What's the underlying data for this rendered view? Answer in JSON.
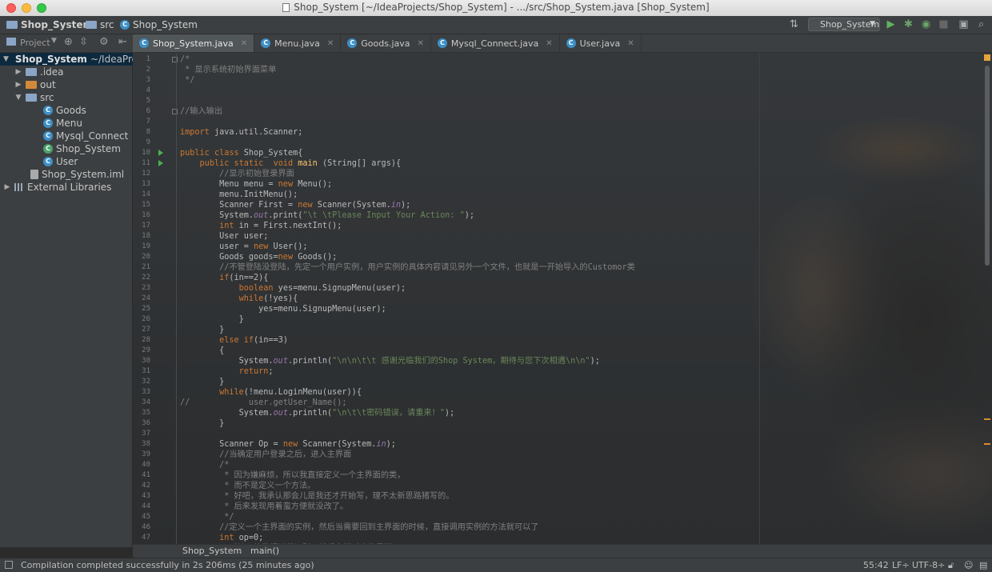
{
  "window": {
    "title": "Shop_System [~/IdeaProjects/Shop_System] - .../src/Shop_System.java [Shop_System]"
  },
  "navbar": {
    "crumbs": [
      "Shop_System",
      "src",
      "Shop_System"
    ],
    "run_config": "Shop_System"
  },
  "project_panel": {
    "label": "Project",
    "tree": [
      {
        "label": "Shop_System",
        "suffix": "~/IdeaPro"
      },
      {
        "label": ".idea"
      },
      {
        "label": "out"
      },
      {
        "label": "src"
      },
      {
        "label": "Goods"
      },
      {
        "label": "Menu"
      },
      {
        "label": "Mysql_Connect"
      },
      {
        "label": "Shop_System"
      },
      {
        "label": "User"
      },
      {
        "label": "Shop_System.iml"
      },
      {
        "label": "External Libraries"
      }
    ]
  },
  "tabs": [
    {
      "label": "Shop_System.java",
      "active": true
    },
    {
      "label": "Menu.java"
    },
    {
      "label": "Goods.java"
    },
    {
      "label": "Mysql_Connect.java"
    },
    {
      "label": "User.java"
    }
  ],
  "editor": {
    "line_count": 48,
    "lines": [
      "/*",
      " * 显示系统初始界面菜单",
      " */",
      "",
      "",
      "//输入输出",
      "",
      "import java.util.Scanner;",
      "",
      "public class Shop_System{",
      "    public static  void main (String[] args){",
      "        //显示初始登录界面",
      "        Menu menu = new Menu();",
      "        menu.InitMenu();",
      "        Scanner First = new Scanner(System.in);",
      "        System.out.print(\"\\t \\tPlease Input Your Action: \");",
      "        int in = First.nextInt();",
      "        User user;",
      "        user = new User();",
      "        Goods goods=new Goods();",
      "        //不管登陆没登陆，先定一个用户实例，用户实例的具体内容请见另外一个文件，也就是一开始导入的Customor类",
      "        if(in==2){",
      "            boolean yes=menu.SignupMenu(user);",
      "            while(!yes){",
      "                yes=menu.SignupMenu(user);",
      "            }",
      "        }",
      "        else if(in==3)",
      "        {",
      "            System.out.println(\"\\n\\n\\t\\t 感谢光临我们的Shop System，期待与您下次相遇\\n\\n\");",
      "            return;",
      "        }",
      "        while(!menu.LoginMenu(user)){",
      "//            user.getUser_Name();",
      "            System.out.println(\"\\n\\t\\t密码错误，请重来！\");",
      "        }",
      "",
      "        Scanner Op = new Scanner(System.in);",
      "        //当确定用户登录之后，进入主界面",
      "        /*",
      "         * 因为嫌麻烦，所以我直接定义一个主界面的类，",
      "         * 而不是定义一个方法。",
      "         * 好吧，我承认那会儿是我还才开始写，理不太新思路猪写的。",
      "         * 后来发现用着蛮方便就没改了。",
      "         */",
      "        //定义一个主界面的实例，然后当需要回到主界面的时候，直接调用实例的方法就可以了",
      "        int op=0;",
      "        //对输入的数据进行识别，然后来相对应的界面"
    ]
  },
  "breadcrumb_strip": {
    "class": "Shop_System",
    "method": "main()"
  },
  "status": {
    "message": "Compilation completed successfully in 2s 206ms (25 minutes ago)",
    "position": "55:42",
    "line_sep": "LF÷",
    "encoding": "UTF-8÷"
  }
}
